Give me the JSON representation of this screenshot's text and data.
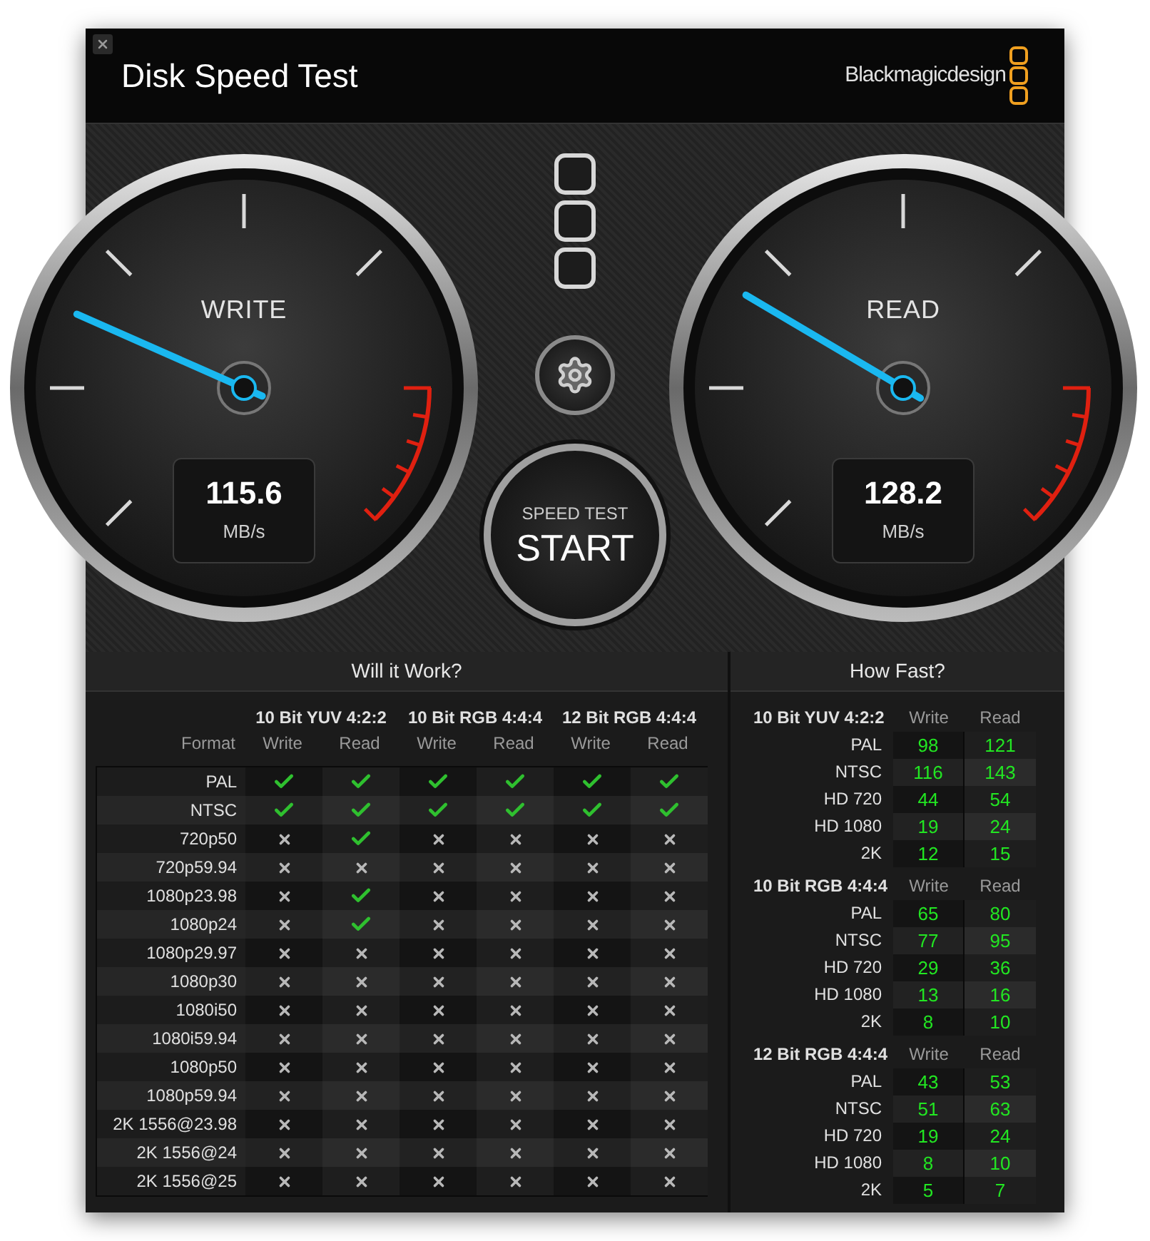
{
  "window": {
    "title": "Disk Speed Test",
    "brand": "Blackmagicdesign"
  },
  "gauges": [
    {
      "label": "WRITE",
      "value": "115.6",
      "unit": "MB/s",
      "level": 0.255
    },
    {
      "label": "READ",
      "value": "128.2",
      "unit": "MB/s",
      "level": 0.28
    }
  ],
  "start_button": {
    "caption": "SPEED TEST",
    "label": "START"
  },
  "will_it_work": {
    "title": "Will it Work?",
    "format_header": "Format",
    "groups": [
      {
        "name": "10 Bit YUV 4:2:2",
        "columns": [
          "Write",
          "Read"
        ]
      },
      {
        "name": "10 Bit RGB 4:4:4",
        "columns": [
          "Write",
          "Read"
        ]
      },
      {
        "name": "12 Bit RGB 4:4:4",
        "columns": [
          "Write",
          "Read"
        ]
      }
    ],
    "rows": [
      {
        "format": "PAL",
        "results": [
          true,
          true,
          true,
          true,
          true,
          true
        ]
      },
      {
        "format": "NTSC",
        "results": [
          true,
          true,
          true,
          true,
          true,
          true
        ]
      },
      {
        "format": "720p50",
        "results": [
          false,
          true,
          false,
          false,
          false,
          false
        ]
      },
      {
        "format": "720p59.94",
        "results": [
          false,
          false,
          false,
          false,
          false,
          false
        ]
      },
      {
        "format": "1080p23.98",
        "results": [
          false,
          true,
          false,
          false,
          false,
          false
        ]
      },
      {
        "format": "1080p24",
        "results": [
          false,
          true,
          false,
          false,
          false,
          false
        ]
      },
      {
        "format": "1080p29.97",
        "results": [
          false,
          false,
          false,
          false,
          false,
          false
        ]
      },
      {
        "format": "1080p30",
        "results": [
          false,
          false,
          false,
          false,
          false,
          false
        ]
      },
      {
        "format": "1080i50",
        "results": [
          false,
          false,
          false,
          false,
          false,
          false
        ]
      },
      {
        "format": "1080i59.94",
        "results": [
          false,
          false,
          false,
          false,
          false,
          false
        ]
      },
      {
        "format": "1080p50",
        "results": [
          false,
          false,
          false,
          false,
          false,
          false
        ]
      },
      {
        "format": "1080p59.94",
        "results": [
          false,
          false,
          false,
          false,
          false,
          false
        ]
      },
      {
        "format": "2K 1556@23.98",
        "results": [
          false,
          false,
          false,
          false,
          false,
          false
        ]
      },
      {
        "format": "2K 1556@24",
        "results": [
          false,
          false,
          false,
          false,
          false,
          false
        ]
      },
      {
        "format": "2K 1556@25",
        "results": [
          false,
          false,
          false,
          false,
          false,
          false
        ]
      }
    ]
  },
  "how_fast": {
    "title": "How Fast?",
    "groups": [
      {
        "name": "10 Bit YUV 4:2:2",
        "write_header": "Write",
        "read_header": "Read",
        "rows": [
          {
            "format": "PAL",
            "write": "98",
            "read": "121"
          },
          {
            "format": "NTSC",
            "write": "116",
            "read": "143"
          },
          {
            "format": "HD 720",
            "write": "44",
            "read": "54"
          },
          {
            "format": "HD 1080",
            "write": "19",
            "read": "24"
          },
          {
            "format": "2K",
            "write": "12",
            "read": "15"
          }
        ]
      },
      {
        "name": "10 Bit RGB 4:4:4",
        "write_header": "Write",
        "read_header": "Read",
        "rows": [
          {
            "format": "PAL",
            "write": "65",
            "read": "80"
          },
          {
            "format": "NTSC",
            "write": "77",
            "read": "95"
          },
          {
            "format": "HD 720",
            "write": "29",
            "read": "36"
          },
          {
            "format": "HD 1080",
            "write": "13",
            "read": "16"
          },
          {
            "format": "2K",
            "write": "8",
            "read": "10"
          }
        ]
      },
      {
        "name": "12 Bit RGB 4:4:4",
        "write_header": "Write",
        "read_header": "Read",
        "rows": [
          {
            "format": "PAL",
            "write": "43",
            "read": "53"
          },
          {
            "format": "NTSC",
            "write": "51",
            "read": "63"
          },
          {
            "format": "HD 720",
            "write": "19",
            "read": "24"
          },
          {
            "format": "HD 1080",
            "write": "8",
            "read": "10"
          },
          {
            "format": "2K",
            "write": "5",
            "read": "7"
          }
        ]
      }
    ]
  }
}
